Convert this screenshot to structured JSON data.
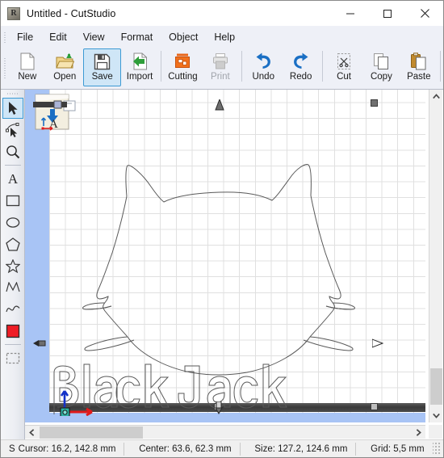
{
  "window": {
    "title": "Untitled - CutStudio",
    "app_icon": "roland-app-icon",
    "minimize_label": "Minimize",
    "maximize_label": "Maximize",
    "close_label": "Close"
  },
  "menubar": {
    "items": [
      {
        "label": "File"
      },
      {
        "label": "Edit"
      },
      {
        "label": "View"
      },
      {
        "label": "Format"
      },
      {
        "label": "Object"
      },
      {
        "label": "Help"
      }
    ]
  },
  "toolbar": {
    "buttons": [
      {
        "label": "New",
        "icon": "new-document-icon",
        "state": "normal"
      },
      {
        "label": "Open",
        "icon": "open-folder-icon",
        "state": "normal"
      },
      {
        "label": "Save",
        "icon": "floppy-disk-icon",
        "state": "selected"
      },
      {
        "label": "Import",
        "icon": "import-arrow-icon",
        "state": "normal"
      },
      {
        "label": "Cutting",
        "icon": "cutting-plotter-icon",
        "state": "normal"
      },
      {
        "label": "Print",
        "icon": "printer-icon",
        "state": "disabled"
      },
      {
        "label": "Undo",
        "icon": "undo-arrow-icon",
        "state": "normal"
      },
      {
        "label": "Redo",
        "icon": "redo-arrow-icon",
        "state": "normal"
      },
      {
        "label": "Cut",
        "icon": "scissors-cut-icon",
        "state": "normal"
      },
      {
        "label": "Copy",
        "icon": "copy-pages-icon",
        "state": "normal"
      },
      {
        "label": "Paste",
        "icon": "clipboard-paste-icon",
        "state": "normal"
      }
    ]
  },
  "palette": {
    "tools": [
      {
        "name": "select-arrow-tool",
        "state": "selected"
      },
      {
        "name": "node-edit-tool",
        "state": "normal"
      },
      {
        "name": "zoom-magnifier-tool",
        "state": "normal"
      },
      {
        "name": "text-tool",
        "state": "normal"
      },
      {
        "name": "rectangle-tool",
        "state": "normal"
      },
      {
        "name": "ellipse-tool",
        "state": "normal"
      },
      {
        "name": "polygon-tool",
        "state": "normal"
      },
      {
        "name": "star-tool",
        "state": "normal"
      },
      {
        "name": "polyline-tool",
        "state": "normal"
      },
      {
        "name": "curve-tool",
        "state": "normal"
      },
      {
        "name": "fill-color-swatch",
        "state": "normal"
      },
      {
        "name": "marquee-select-tool",
        "state": "normal"
      }
    ],
    "fill_color": "#ee1c25"
  },
  "canvas": {
    "artwork_name": "black-jack-cat-outline",
    "artwork_text": "Black Jack",
    "media_color": "#a8c4f5",
    "sheet_color": "#ffffff",
    "grid_color": "#e0e0e0",
    "cut_strip_color": "#3a3a3a",
    "selection_handles": 8
  },
  "scrollbars": {
    "vertical": {
      "up_arrow": "chevron-up-icon",
      "down_arrow": "chevron-down-icon"
    },
    "horizontal": {
      "left_arrow": "chevron-left-icon",
      "right_arrow": "chevron-right-icon"
    }
  },
  "statusbar": {
    "prefix": "S",
    "cursor": "Cursor: 16.2, 142.8 mm",
    "center": "Center: 63.6, 62.3 mm",
    "size": "Size: 127.2, 124.6 mm",
    "grid": "Grid: 5,5 mm"
  }
}
